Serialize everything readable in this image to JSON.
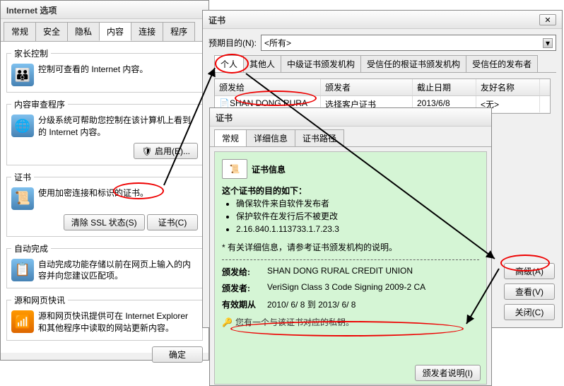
{
  "opts": {
    "title": "Internet 选项",
    "tabs": {
      "general": "常规",
      "security": "安全",
      "privacy": "隐私",
      "content": "内容",
      "connections": "连接",
      "programs": "程序"
    },
    "parental": {
      "legend": "家长控制",
      "desc": "控制可查看的 Internet 内容。"
    },
    "contentAdvisor": {
      "legend": "内容审查程序",
      "desc": "分级系统可帮助您控制在该计算机上看到的 Internet 内容。",
      "enableBtn": "启用(E)..."
    },
    "certs": {
      "legend": "证书",
      "desc": "使用加密连接和标识的证书。",
      "clearSSL": "清除 SSL 状态(S)",
      "certBtn": "证书(C)"
    },
    "autocomplete": {
      "legend": "自动完成",
      "desc": "自动完成功能存储以前在网页上输入的内容并向您建议匹配项。"
    },
    "feeds": {
      "legend": "源和网页快讯",
      "desc": "源和网页快讯提供可在 Internet Explorer 和其他程序中读取的网站更新内容。"
    },
    "okBtn": "确定"
  },
  "certWin": {
    "title": "证书",
    "purposeLabel": "预期目的(N):",
    "purposeValue": "<所有>",
    "tabs": {
      "personal": "个人",
      "others": "其他人",
      "intermediate": "中级证书颁发机构",
      "trustedRoot": "受信任的根证书颁发机构",
      "trustedPub": "受信任的发布者"
    },
    "headers": {
      "to": "颁发给",
      "by": "颁发者",
      "exp": "截止日期",
      "friendly": "友好名称"
    },
    "rows": [
      {
        "to": "SHAN DONG RURA",
        "by": "选择客户证书",
        "exp": "2013/6/8",
        "friendly": "<无>"
      }
    ],
    "buttons": {
      "advanced": "高级(A)",
      "view": "查看(V)",
      "close": "关闭(C)"
    }
  },
  "detailWin": {
    "title": "证书",
    "tabs": {
      "general": "常规",
      "details": "详细信息",
      "path": "证书路径"
    },
    "heading": "证书信息",
    "purposeTitle": "这个证书的目的如下：",
    "purposes": [
      "确保软件来自软件发布者",
      "保护软件在发行后不被更改",
      "2.16.840.1.113733.1.7.23.3"
    ],
    "moreinfo": "*  有关详细信息，请参考证书颁发机构的说明。",
    "to_label": "颁发给:",
    "to_value": "SHAN DONG RURAL CREDIT UNION",
    "by_label": "颁发者:",
    "by_value": "VeriSign Class 3 Code Signing 2009-2 CA",
    "valid_label": "有效期从",
    "valid_from": "2010/ 6/ 8",
    "valid_to_word": "到",
    "valid_to": "2013/ 6/ 8",
    "key_note": "您有一个与该证书对应的私钥。",
    "issuer_btn": "颁发者说明(I)"
  }
}
